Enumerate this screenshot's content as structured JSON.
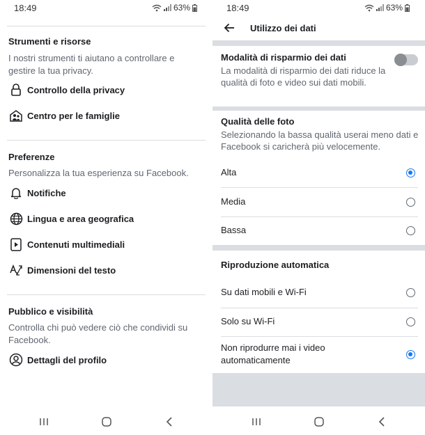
{
  "status": {
    "time": "18:49",
    "battery": "63%"
  },
  "left": {
    "sections": [
      {
        "title": "Strumenti e risorse",
        "desc": "I nostri strumenti ti aiutano a controllare e gestire la tua privacy.",
        "items": [
          {
            "label": "Controllo della privacy",
            "icon": "lock-icon"
          },
          {
            "label": "Centro per le famiglie",
            "icon": "family-icon"
          }
        ]
      },
      {
        "title": "Preferenze",
        "desc": "Personalizza la tua esperienza su Facebook.",
        "items": [
          {
            "label": "Notifiche",
            "icon": "bell-icon"
          },
          {
            "label": "Lingua e area geografica",
            "icon": "globe-icon"
          },
          {
            "label": "Contenuti multimediali",
            "icon": "media-icon"
          },
          {
            "label": "Dimensioni del testo",
            "icon": "text-size-icon"
          }
        ]
      },
      {
        "title": "Pubblico e visibilità",
        "desc": "Controlla chi può vedere ciò che condividi su Facebook.",
        "items": [
          {
            "label": "Dettagli del profilo",
            "icon": "profile-icon"
          }
        ]
      }
    ]
  },
  "right": {
    "title": "Utilizzo dei dati",
    "data_saver": {
      "title": "Modalità di risparmio dei dati",
      "desc": "La modalità di risparmio dei dati riduce la qualità di foto e video sui dati mobili.",
      "enabled": false
    },
    "photo_quality": {
      "title": "Qualità delle foto",
      "desc": "Selezionando la bassa qualità userai meno dati e Facebook si caricherà più velocemente.",
      "options": [
        "Alta",
        "Media",
        "Bassa"
      ],
      "selected": "Alta"
    },
    "autoplay": {
      "title": "Riproduzione automatica",
      "options": [
        "Su dati mobili e Wi-Fi",
        "Solo su Wi-Fi",
        "Non riprodurre mai i video automaticamente"
      ],
      "selected": "Non riprodurre mai i video automaticamente"
    }
  },
  "colors": {
    "accent": "#1877f2",
    "separator": "#dadde1",
    "secondary_text": "#606770"
  }
}
